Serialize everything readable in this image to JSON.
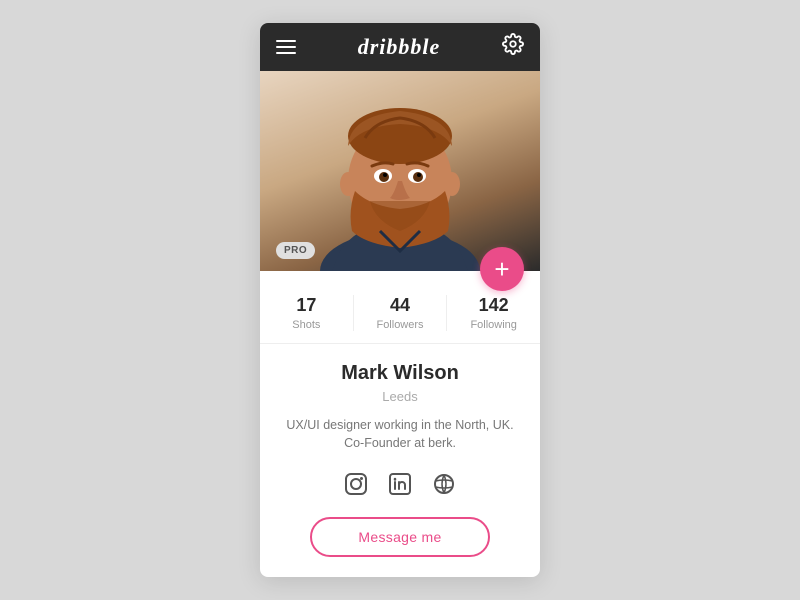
{
  "navbar": {
    "logo": "dribbble",
    "menu_icon_label": "menu",
    "gear_icon_label": "settings"
  },
  "profile": {
    "pro_badge": "PRO",
    "add_button_label": "+",
    "stats": [
      {
        "number": "17",
        "label": "Shots"
      },
      {
        "number": "44",
        "label": "Followers"
      },
      {
        "number": "142",
        "label": "Following"
      }
    ],
    "name": "Mark Wilson",
    "location": "Leeds",
    "bio": "UX/UI designer working in the North, UK.\nCo-Founder at berk.",
    "social_links": [
      "instagram",
      "linkedin",
      "globe"
    ],
    "message_button_label": "Message me"
  }
}
